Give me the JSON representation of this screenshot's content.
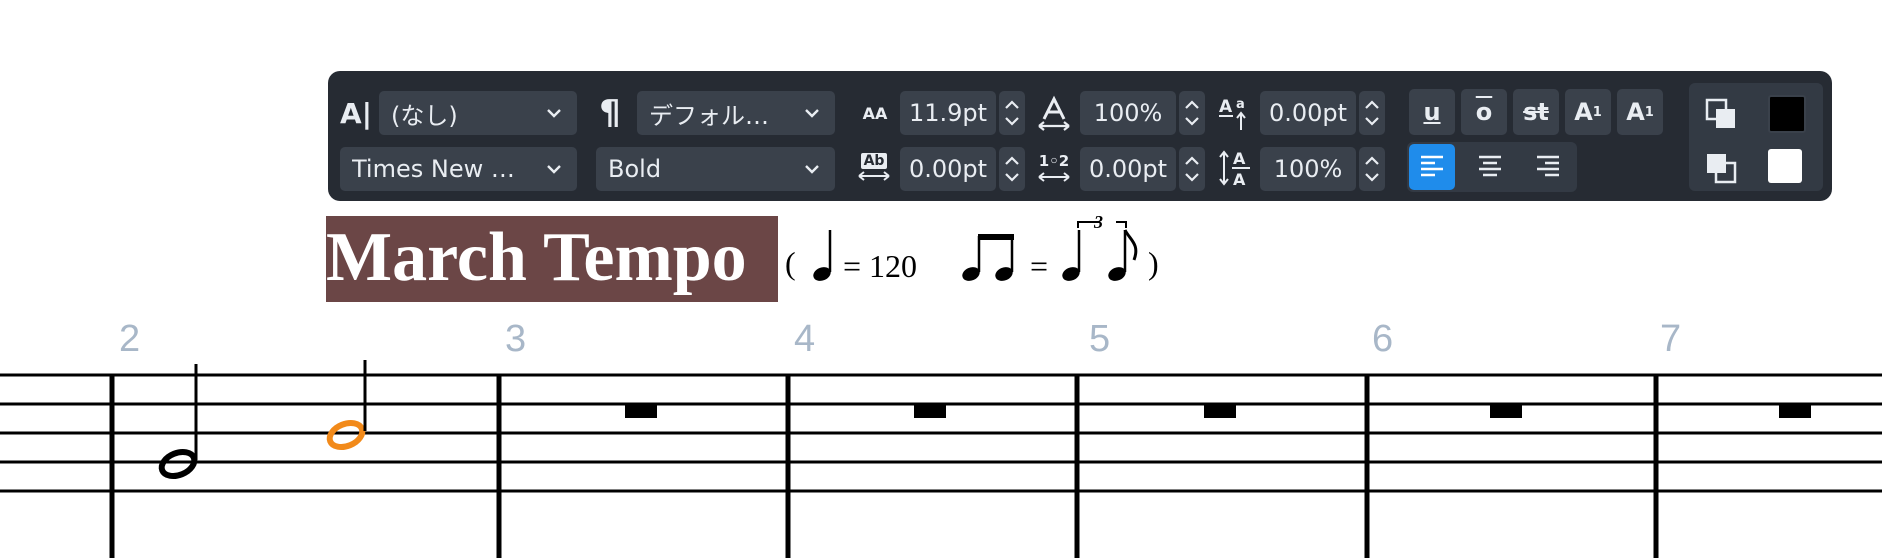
{
  "toolbar": {
    "paragraph_style": "(なし)",
    "character_style": "デフォル…",
    "font_family": "Times New …",
    "font_style": "Bold",
    "font_size": "11.9pt",
    "horizontal_scale": "100%",
    "baseline_offset": "0.00pt",
    "letter_spacing": "0.00pt",
    "word_spacing": "0.00pt",
    "line_spacing": "100%",
    "underline_label": "u",
    "overline_label": "o",
    "strikethrough_label": "st",
    "superscript_label": "A",
    "superscript_small": "1",
    "subscript_label": "A",
    "subscript_small": "1",
    "font_size_icon_label": "AA",
    "letter_spacing_icon_label": "Ab",
    "word_spacing_icon_label": "1◦2",
    "alignment_selected": "left",
    "foreground_color": "#000000",
    "background_color": "#ffffff",
    "accent_color": "#1f8ceb"
  },
  "tempo": {
    "title": "March Tempo",
    "paren_open": "(",
    "equals_120": "= 120",
    "equals": "=",
    "tuplet_number": "3",
    "paren_close": ")"
  },
  "score": {
    "measure_numbers": [
      "2",
      "3",
      "4",
      "5",
      "6",
      "7"
    ],
    "selected_note_color": "#f28a1a"
  }
}
